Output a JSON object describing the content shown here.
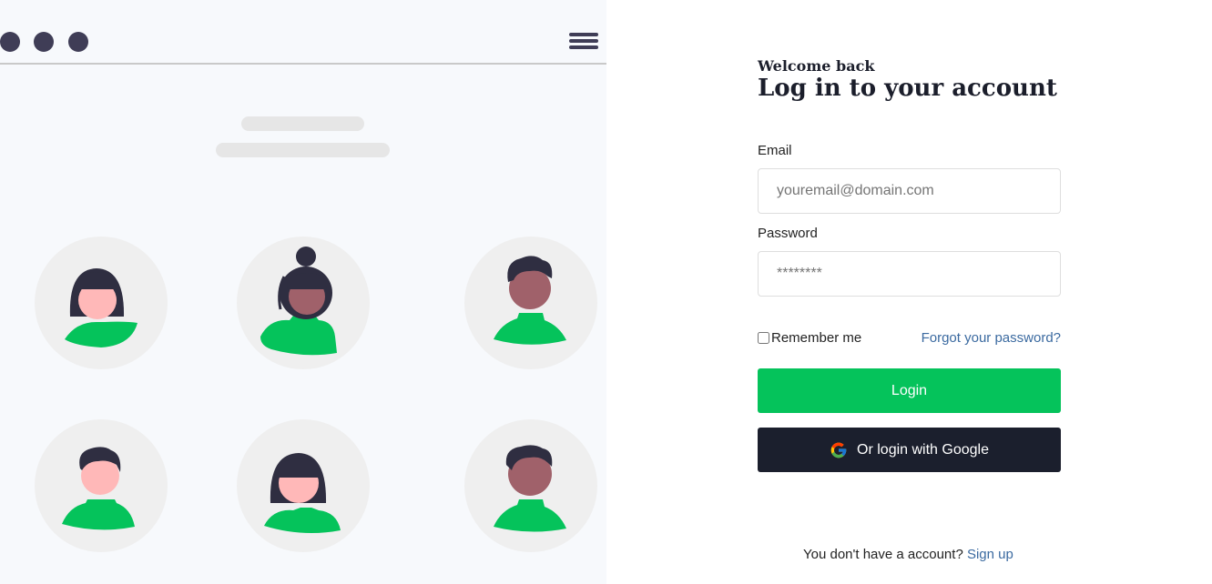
{
  "illustration": {
    "avatars": [
      {
        "name": "avatar-woman-bob-light"
      },
      {
        "name": "avatar-woman-bun-dark"
      },
      {
        "name": "avatar-man-dark"
      },
      {
        "name": "avatar-man-light"
      },
      {
        "name": "avatar-woman-bangs-light"
      },
      {
        "name": "avatar-man-dark-2"
      }
    ],
    "colors": {
      "background": "#f7f9fc",
      "circle": "#efefef",
      "shirt": "#05c35b",
      "hair": "#2f2e41",
      "skin_light": "#ffb8b8",
      "skin_dark": "#a0616a",
      "window_dots": "#3f3d56"
    }
  },
  "form": {
    "welcome": "Welcome back",
    "title": "Log in to your account",
    "email_label": "Email",
    "email_placeholder": "youremail@domain.com",
    "password_label": "Password",
    "password_placeholder": "********",
    "remember_label": "Remember me",
    "forgot_link": "Forgot your password?",
    "login_button": "Login",
    "google_button": "Or login with Google",
    "signup_text": "You don't have a account?",
    "signup_link": "Sign up",
    "colors": {
      "login_button": "#05c35b",
      "google_button": "#1b1f2d",
      "link": "#3b6aa0"
    }
  }
}
